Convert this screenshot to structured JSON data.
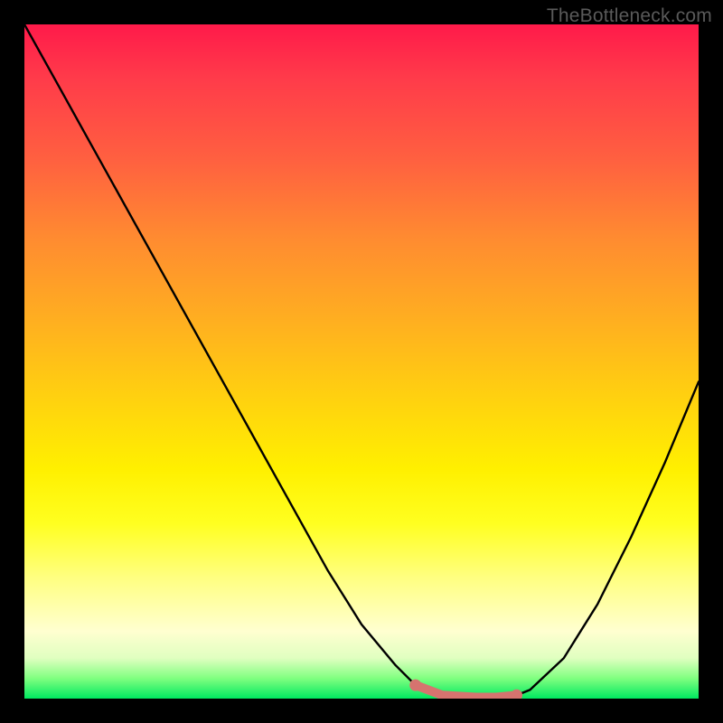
{
  "watermark": "TheBottleneck.com",
  "chart_data": {
    "type": "line",
    "title": "",
    "xlabel": "",
    "ylabel": "",
    "xlim": [
      0,
      100
    ],
    "ylim": [
      0,
      100
    ],
    "series": [
      {
        "name": "curve",
        "x": [
          0,
          5,
          10,
          15,
          20,
          25,
          30,
          35,
          40,
          45,
          50,
          55,
          58,
          62,
          67,
          70,
          73,
          75,
          80,
          85,
          90,
          95,
          100
        ],
        "y": [
          100,
          91,
          82,
          73,
          64,
          55,
          46,
          37,
          28,
          19,
          11,
          5,
          2,
          0.5,
          0.2,
          0.2,
          0.5,
          1.3,
          6,
          14,
          24,
          35,
          47
        ]
      }
    ],
    "highlight": {
      "name": "bottom-plateau",
      "x_start": 58,
      "x_end": 73,
      "color": "#d6736f"
    },
    "background_gradient": {
      "top": "#ff1a4a",
      "mid": "#fff000",
      "bottom": "#00e860"
    }
  }
}
